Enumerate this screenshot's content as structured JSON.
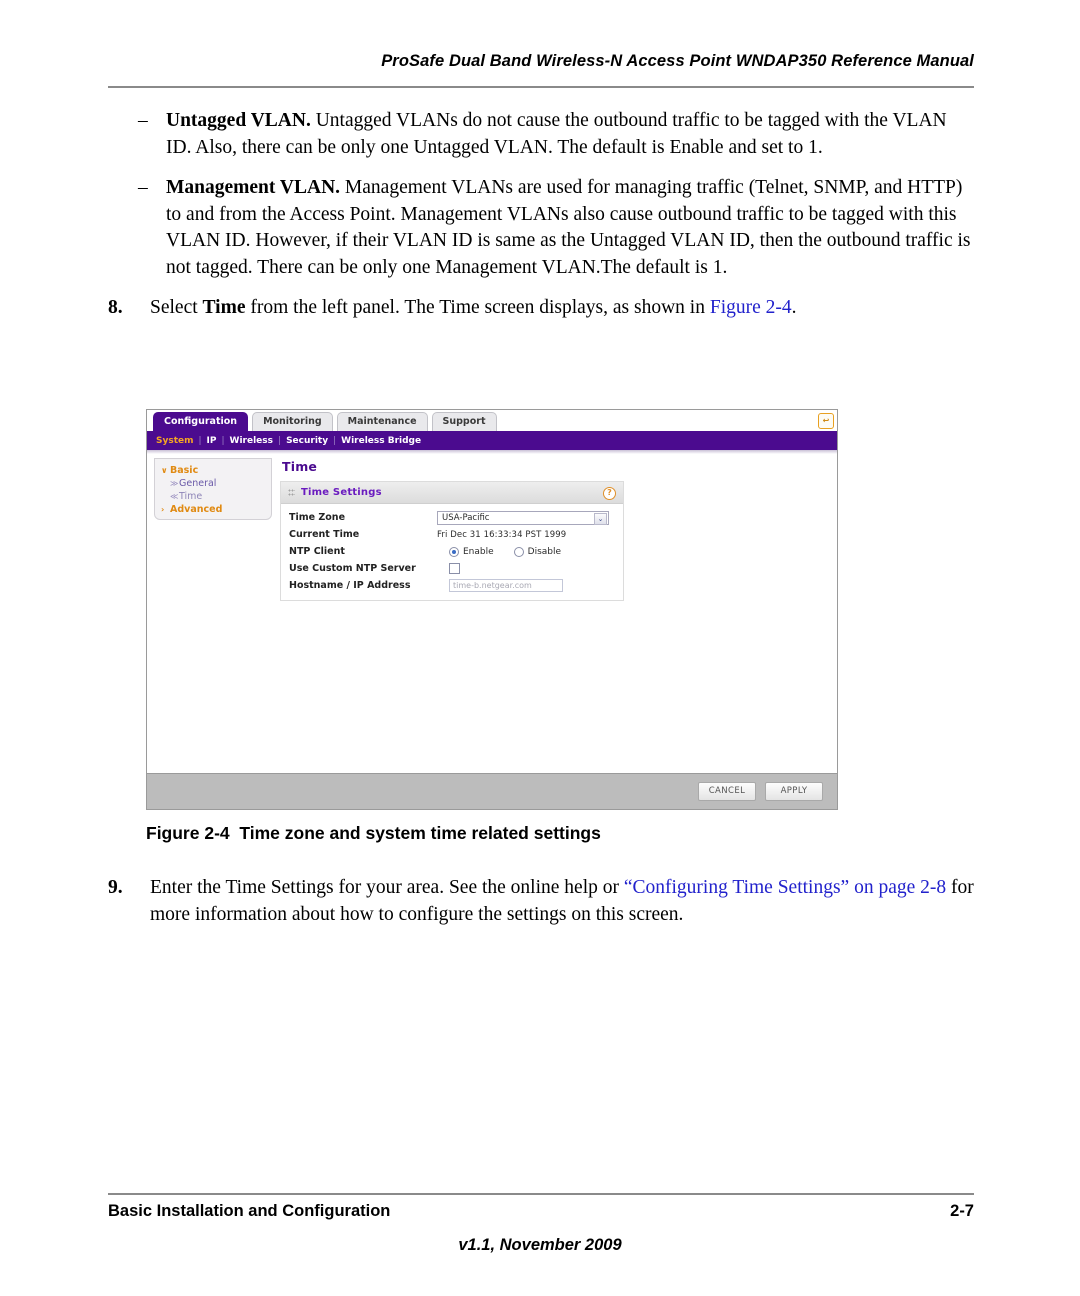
{
  "header": {
    "running_title": "ProSafe Dual Band Wireless-N Access Point WNDAP350 Reference Manual"
  },
  "body": {
    "bullets": [
      {
        "marker": "–",
        "term": "Untagged VLAN.",
        "text": " Untagged VLANs do not cause the outbound traffic to be tagged with the VLAN ID. Also, there can be only one Untagged VLAN. The default is Enable and set to 1."
      },
      {
        "marker": "–",
        "term": "Management VLAN.",
        "text": " Management VLANs are used for managing traffic (Telnet, SNMP, and HTTP) to and from the Access Point. Management VLANs also cause outbound traffic to be tagged with this VLAN ID. However, if their VLAN ID is same as the Untagged VLAN ID, then the outbound traffic is not tagged. There can be only one Management VLAN.The default is 1."
      }
    ],
    "step8": {
      "number": "8.",
      "text_before": "Select ",
      "bold_term": "Time",
      "text_middle": " from the left panel. The Time screen displays, as shown in ",
      "link": "Figure 2-4",
      "text_after": "."
    },
    "step9": {
      "number": "9.",
      "text_before": "Enter the Time Settings for your area. See the online help or ",
      "link1": "“Configuring Time Settings” on page 2-8",
      "text_after": " for more information about how to configure the settings on this screen."
    }
  },
  "figure": {
    "caption_label": "Figure 2-4",
    "caption_text": "Time zone and system time related settings",
    "app": {
      "tabs": [
        {
          "label": "Configuration",
          "active": true
        },
        {
          "label": "Monitoring",
          "active": false
        },
        {
          "label": "Maintenance",
          "active": false
        },
        {
          "label": "Support",
          "active": false
        }
      ],
      "logout_icon_glyph": "↩",
      "submenu": [
        {
          "label": "System",
          "selected": true
        },
        {
          "label": "IP",
          "selected": false
        },
        {
          "label": "Wireless",
          "selected": false
        },
        {
          "label": "Security",
          "selected": false
        },
        {
          "label": "Wireless Bridge",
          "selected": false
        }
      ],
      "submenu_separator": "|",
      "sidebar": [
        {
          "caret": "∨",
          "label": "Basic",
          "level": "top"
        },
        {
          "caret": "≫",
          "label": "General",
          "level": "sub"
        },
        {
          "caret": "≪",
          "label": "Time",
          "level": "sub-current"
        },
        {
          "caret": "›",
          "label": "Advanced",
          "level": "top"
        }
      ],
      "pane_title": "Time",
      "card": {
        "title": "Time Settings",
        "help_glyph": "?",
        "rows": [
          {
            "label": "Time Zone",
            "type": "select",
            "value": "USA-Pacific",
            "arrow": "⌄"
          },
          {
            "label": "Current Time",
            "type": "text",
            "value": "Fri Dec 31 16:33:34 PST 1999"
          },
          {
            "label": "NTP Client",
            "type": "radio",
            "options": [
              {
                "label": "Enable",
                "checked": true
              },
              {
                "label": "Disable",
                "checked": false
              }
            ]
          },
          {
            "label": "Use Custom NTP Server",
            "type": "checkbox",
            "checked": false
          },
          {
            "label": "Hostname / IP Address",
            "type": "input",
            "value": "time-b.netgear.com"
          }
        ]
      },
      "buttons": [
        {
          "label": "CANCEL"
        },
        {
          "label": "APPLY"
        }
      ]
    }
  },
  "footer": {
    "left": "Basic Installation and Configuration",
    "right": "2-7",
    "version": "v1.1, November 2009"
  },
  "colors": {
    "brand_purple": "#4b0b8f",
    "accent_orange": "#e08a12",
    "link_blue": "#2222cc"
  }
}
